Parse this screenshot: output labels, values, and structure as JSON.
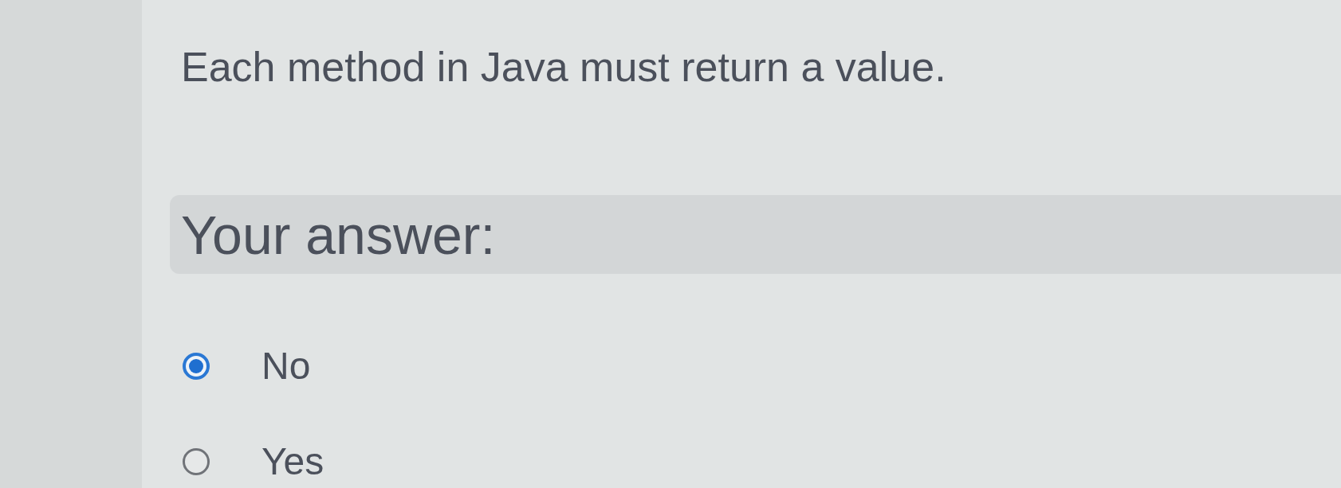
{
  "question": {
    "text": "Each method in Java must return a value."
  },
  "answer_section": {
    "label": "Your answer:"
  },
  "options": [
    {
      "label": "No",
      "selected": true
    },
    {
      "label": "Yes",
      "selected": false
    }
  ]
}
